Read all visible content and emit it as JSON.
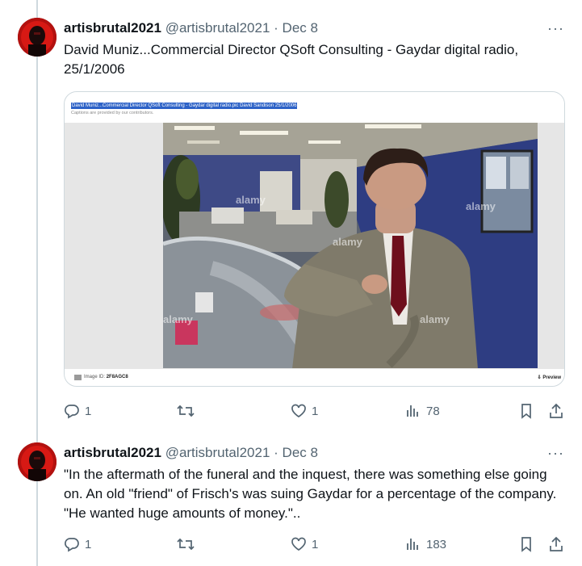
{
  "tweets": [
    {
      "author": "artisbrutal2021",
      "handle": "@artisbrutal2021",
      "separator": "·",
      "date": "Dec 8",
      "more": "···",
      "text": "David Muniz...Commercial Director QSoft Consulting - Gaydar digital radio, 25/1/2006",
      "media": {
        "caption_highlight": "David Muniz...Commercial Director QSoft Consulting - Gaydar digital radio.pic David Sandison 25/1/2006",
        "caption_sub": "Captions are provided by our contributors.",
        "id_label": "Image ID:",
        "id_value": "2F8AGC8",
        "preview_label": "Preview",
        "watermarks": [
          "alamy",
          "alamy",
          "alamy",
          "alamy",
          "alamy"
        ]
      },
      "stats": {
        "replies": "1",
        "retweets": "",
        "likes": "1",
        "views": "78"
      }
    },
    {
      "author": "artisbrutal2021",
      "handle": "@artisbrutal2021",
      "separator": "·",
      "date": "Dec 8",
      "more": "···",
      "text": "\"In the aftermath of the funeral and the inquest, there was something  else going on. An old \"friend\" of Frisch's was suing Gaydar for a  percentage of the company. \"He wanted huge amounts of money.\"..",
      "stats": {
        "replies": "1",
        "retweets": "",
        "likes": "1",
        "views": "183"
      }
    }
  ],
  "icons": {
    "reply": "reply-icon",
    "retweet": "retweet-icon",
    "like": "heart-icon",
    "views": "views-icon",
    "bookmark": "bookmark-icon",
    "share": "share-icon"
  },
  "colors": {
    "text_primary": "#0f1419",
    "text_secondary": "#536471",
    "border": "#cfd9de",
    "caption_highlight": "#2d62c7"
  }
}
